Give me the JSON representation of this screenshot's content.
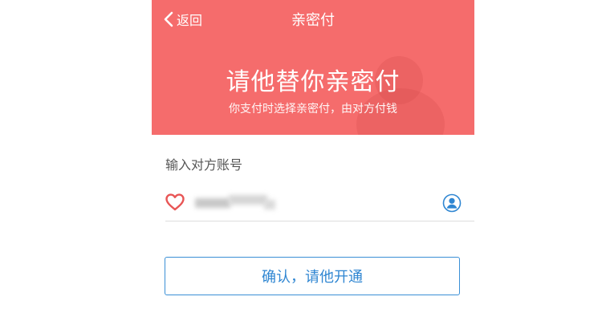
{
  "navbar": {
    "back_label": "返回",
    "title": "亲密付"
  },
  "hero": {
    "title": "请他替你亲密付",
    "subtitle": "你支付时选择亲密付，由对方付钱"
  },
  "account": {
    "section_label": "输入对方账号"
  },
  "confirm_button": {
    "label": "确认，请他开通"
  },
  "colors": {
    "header_bg": "#f56c6c",
    "accent_blue": "#2f86d2",
    "heart": "#e85555"
  },
  "icons": {
    "back": "chevron-left-icon",
    "heart": "heart-outline-icon",
    "contacts": "person-circle-icon"
  }
}
